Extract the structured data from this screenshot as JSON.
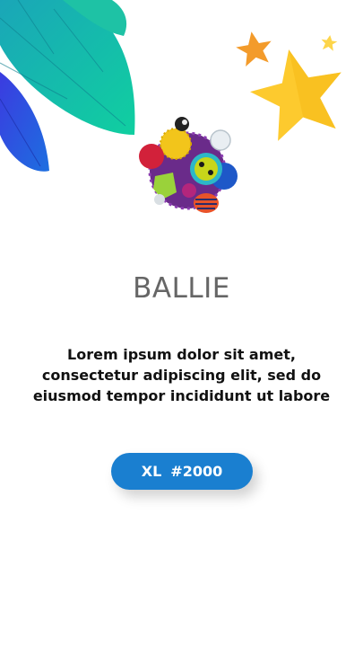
{
  "product": {
    "title": "BALLIE",
    "description": "Lorem ipsum dolor sit amet, consectetur adipiscing elit, sed do eiusmod tempor incididunt ut labore",
    "image_icon": "toy-ball"
  },
  "cta": {
    "size": "XL",
    "code": "#2000"
  },
  "colors": {
    "accent": "#1a7fd0",
    "title": "#666666",
    "star": "#fdca2e",
    "star_orange": "#f39b2b",
    "leaf_teal": "#14c1a8",
    "leaf_blue": "#2a45d6"
  }
}
